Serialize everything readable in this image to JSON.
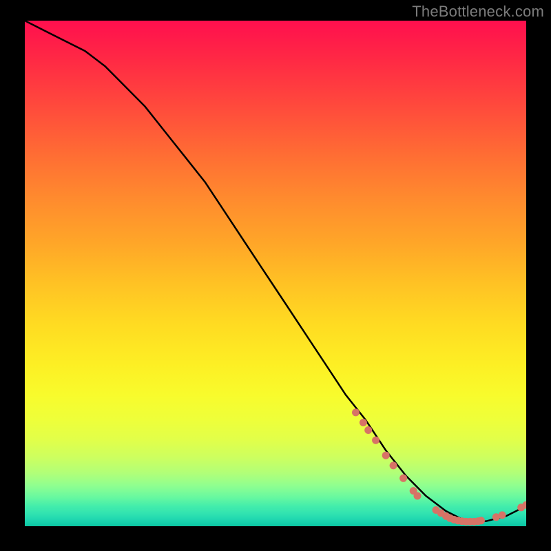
{
  "watermark": "TheBottleneck.com",
  "chart_data": {
    "type": "line",
    "title": "",
    "xlabel": "",
    "ylabel": "",
    "xlim": [
      0,
      100
    ],
    "ylim": [
      0,
      100
    ],
    "grid": false,
    "legend": false,
    "series": [
      {
        "name": "bottleneck-curve",
        "color": "#000000",
        "x": [
          0,
          4,
          8,
          12,
          16,
          20,
          24,
          28,
          32,
          36,
          40,
          44,
          48,
          52,
          56,
          60,
          64,
          68,
          72,
          76,
          80,
          84,
          88,
          92,
          96,
          100
        ],
        "y": [
          100,
          98,
          96,
          94,
          91,
          87,
          83,
          78,
          73,
          68,
          62,
          56,
          50,
          44,
          38,
          32,
          26,
          21,
          15,
          10,
          6,
          3,
          1,
          1,
          2,
          4
        ]
      }
    ],
    "markers": [
      {
        "name": "curve-dots",
        "shape": "circle",
        "radius": 5.5,
        "color": "#d77366",
        "points": [
          {
            "x": 66,
            "y": 22.5
          },
          {
            "x": 67.5,
            "y": 20.5
          },
          {
            "x": 68.5,
            "y": 19
          },
          {
            "x": 70,
            "y": 17
          },
          {
            "x": 72,
            "y": 14
          },
          {
            "x": 73.5,
            "y": 12
          },
          {
            "x": 75.5,
            "y": 9.5
          },
          {
            "x": 77.5,
            "y": 7
          },
          {
            "x": 78.3,
            "y": 6
          },
          {
            "x": 82,
            "y": 3.2
          },
          {
            "x": 83,
            "y": 2.6
          },
          {
            "x": 84,
            "y": 2
          },
          {
            "x": 84.8,
            "y": 1.6
          },
          {
            "x": 85.6,
            "y": 1.3
          },
          {
            "x": 86.4,
            "y": 1.1
          },
          {
            "x": 87.2,
            "y": 1.0
          },
          {
            "x": 88,
            "y": 0.9
          },
          {
            "x": 88.8,
            "y": 0.9
          },
          {
            "x": 89.6,
            "y": 0.9
          },
          {
            "x": 90.4,
            "y": 1.0
          },
          {
            "x": 91,
            "y": 1.1
          },
          {
            "x": 94,
            "y": 1.8
          },
          {
            "x": 95.2,
            "y": 2.2
          },
          {
            "x": 99,
            "y": 3.7
          },
          {
            "x": 100,
            "y": 4.2
          }
        ]
      }
    ],
    "background_gradient": {
      "stops": [
        {
          "pct": 0,
          "color": "#ff0f4e"
        },
        {
          "pct": 35,
          "color": "#ff8a2e"
        },
        {
          "pct": 60,
          "color": "#ffdb22"
        },
        {
          "pct": 80,
          "color": "#e1ff4a"
        },
        {
          "pct": 92,
          "color": "#8fff90"
        },
        {
          "pct": 100,
          "color": "#0cc6a2"
        }
      ]
    }
  }
}
